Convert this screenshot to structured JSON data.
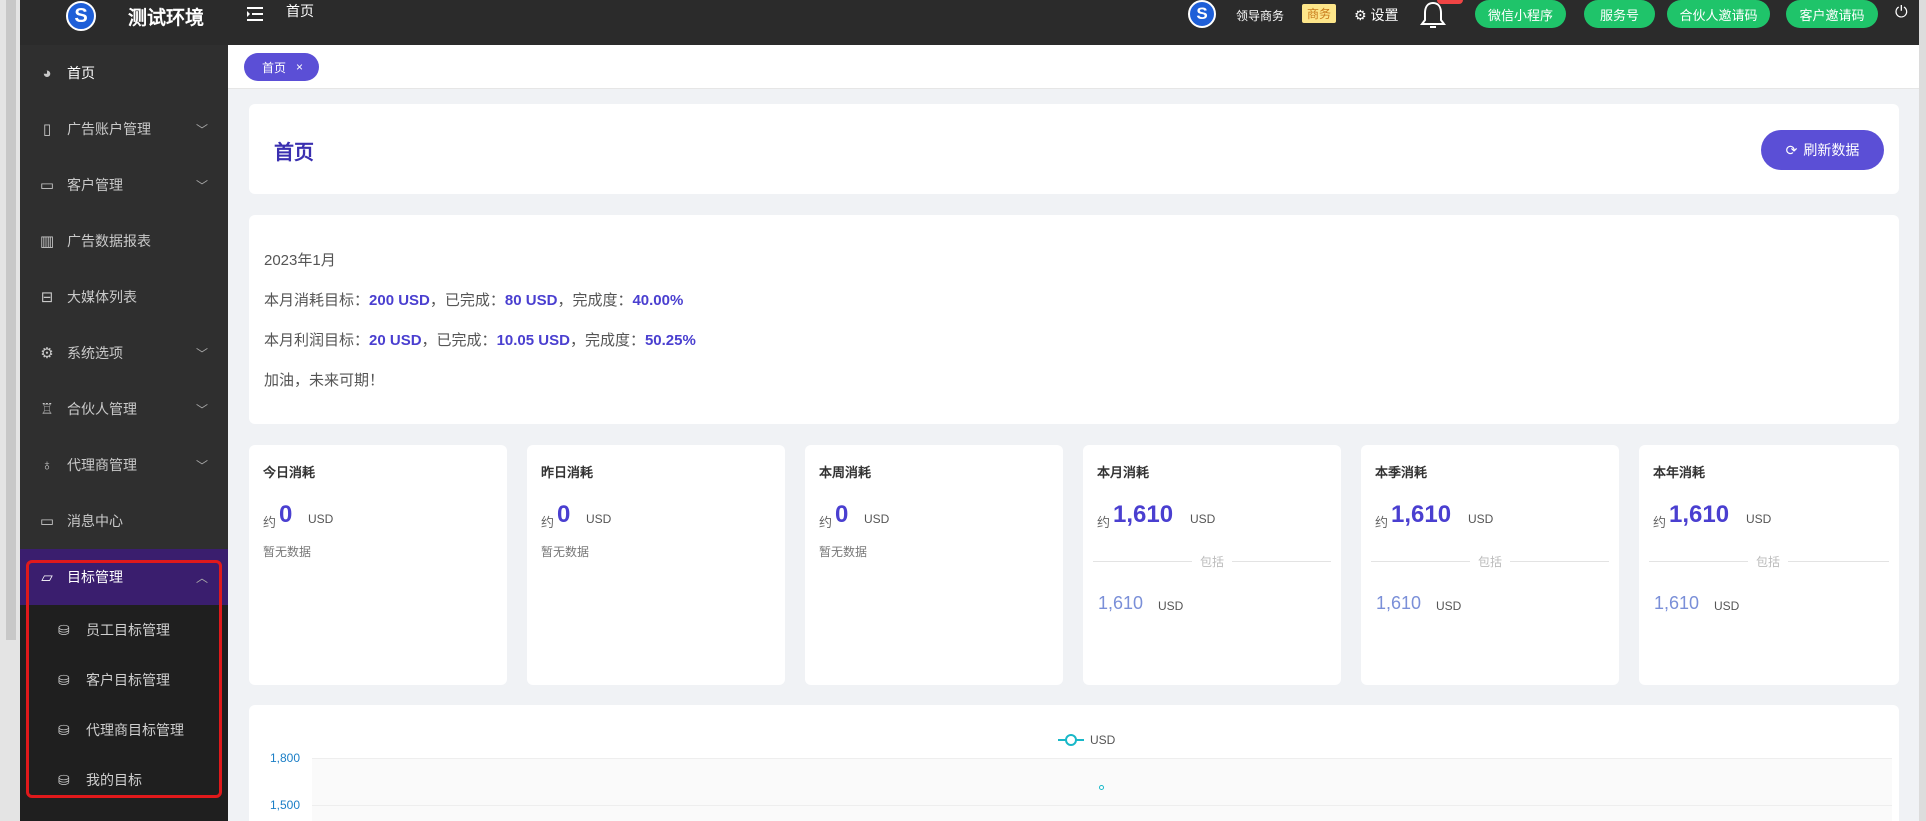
{
  "brand": {
    "logo_letter": "S",
    "title": "测试环境"
  },
  "topbar": {
    "menu_icon": "hamburger-icon",
    "home_label": "首页",
    "user_avatar_letter": "S",
    "user_name": "领导商务",
    "role_badge": "商务",
    "settings_label": "设置",
    "buttons": [
      {
        "label": "微信小程序"
      },
      {
        "label": "服务号"
      },
      {
        "label": "合伙人邀请码"
      },
      {
        "label": "客户邀请码"
      }
    ],
    "accent_green": "#1fc46a",
    "accent_purple": "#5b4fd6"
  },
  "sidebar": {
    "items": [
      {
        "label": "首页",
        "icon": "dashboard-icon",
        "has_children": false
      },
      {
        "label": "广告账户管理",
        "icon": "tablet-icon",
        "has_children": true
      },
      {
        "label": "客户管理",
        "icon": "book-icon",
        "has_children": true
      },
      {
        "label": "广告数据报表",
        "icon": "bar-chart-icon",
        "has_children": false
      },
      {
        "label": "大媒体列表",
        "icon": "layers-icon",
        "has_children": false
      },
      {
        "label": "系统选项",
        "icon": "gear-icon",
        "has_children": true
      },
      {
        "label": "合伙人管理",
        "icon": "trophy-icon",
        "has_children": true
      },
      {
        "label": "代理商管理",
        "icon": "medal-icon",
        "has_children": true
      },
      {
        "label": "消息中心",
        "icon": "chat-icon",
        "has_children": false
      },
      {
        "label": "目标管理",
        "icon": "folder-icon",
        "has_children": true,
        "expanded": true
      }
    ],
    "sub_items": [
      {
        "label": "员工目标管理",
        "icon": "database-icon"
      },
      {
        "label": "客户目标管理",
        "icon": "database-icon"
      },
      {
        "label": "代理商目标管理",
        "icon": "database-icon"
      },
      {
        "label": "我的目标",
        "icon": "database-icon"
      }
    ]
  },
  "tabs": [
    {
      "label": "首页",
      "close": "×"
    }
  ],
  "header": {
    "title": "首页",
    "refresh_label": "刷新数据"
  },
  "summary": {
    "month": "2023年1月",
    "line1": {
      "prefix": "本月消耗目标：",
      "target": "200 USD",
      "mid1": "，已完成：",
      "done": "80 USD",
      "mid2": "，完成度：",
      "pct": "40.00%"
    },
    "line2": {
      "prefix": "本月利润目标：",
      "target": "20 USD",
      "mid1": "，已完成：",
      "done": "10.05 USD",
      "mid2": "，完成度：",
      "pct": "50.25%"
    },
    "motto": "加油，未来可期！"
  },
  "stats": [
    {
      "title": "今日消耗",
      "approx": "约",
      "value": "0",
      "unit": "USD",
      "empty": "暂无数据"
    },
    {
      "title": "昨日消耗",
      "approx": "约",
      "value": "0",
      "unit": "USD",
      "empty": "暂无数据"
    },
    {
      "title": "本周消耗",
      "approx": "约",
      "value": "0",
      "unit": "USD",
      "empty": "暂无数据"
    },
    {
      "title": "本月消耗",
      "approx": "约",
      "value": "1,610",
      "unit": "USD",
      "include_label": "包括",
      "sub_value": "1,610",
      "sub_unit": "USD"
    },
    {
      "title": "本季消耗",
      "approx": "约",
      "value": "1,610",
      "unit": "USD",
      "include_label": "包括",
      "sub_value": "1,610",
      "sub_unit": "USD"
    },
    {
      "title": "本年消耗",
      "approx": "约",
      "value": "1,610",
      "unit": "USD",
      "include_label": "包括",
      "sub_value": "1,610",
      "sub_unit": "USD"
    }
  ],
  "chart_data": {
    "type": "line",
    "series": [
      {
        "name": "USD",
        "values": [
          1610
        ]
      }
    ],
    "yticks": [
      "1,800",
      "1,500"
    ],
    "ylim": [
      1500,
      1800
    ],
    "color": "#19b8c8"
  }
}
